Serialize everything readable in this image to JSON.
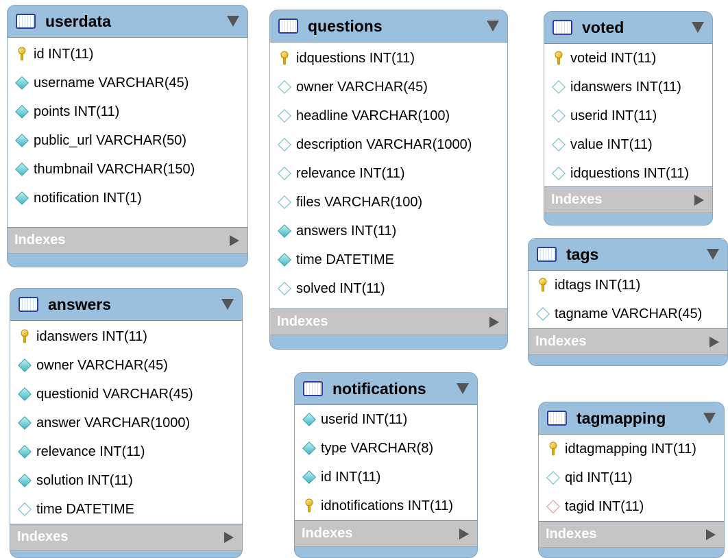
{
  "indexes_label": "Indexes",
  "tables": {
    "userdata": {
      "name": "userdata",
      "columns": [
        {
          "text": "id INT(11)",
          "icon": "key-icon"
        },
        {
          "text": "username VARCHAR(45)",
          "icon": "filled-diamond-icon"
        },
        {
          "text": "points INT(11)",
          "icon": "filled-diamond-icon"
        },
        {
          "text": "public_url VARCHAR(50)",
          "icon": "filled-diamond-icon"
        },
        {
          "text": "thumbnail VARCHAR(150)",
          "icon": "filled-diamond-icon"
        },
        {
          "text": "notification INT(1)",
          "icon": "filled-diamond-icon"
        }
      ]
    },
    "questions": {
      "name": "questions",
      "columns": [
        {
          "text": "idquestions INT(11)",
          "icon": "key-icon"
        },
        {
          "text": "owner VARCHAR(45)",
          "icon": "hollow-diamond-icon"
        },
        {
          "text": "headline VARCHAR(100)",
          "icon": "hollow-diamond-icon"
        },
        {
          "text": "description VARCHAR(1000)",
          "icon": "hollow-diamond-icon"
        },
        {
          "text": "relevance INT(11)",
          "icon": "hollow-diamond-icon"
        },
        {
          "text": "files VARCHAR(100)",
          "icon": "hollow-diamond-icon"
        },
        {
          "text": "answers INT(11)",
          "icon": "filled-diamond-icon"
        },
        {
          "text": "time DATETIME",
          "icon": "filled-diamond-icon"
        },
        {
          "text": "solved INT(11)",
          "icon": "hollow-diamond-icon"
        }
      ]
    },
    "voted": {
      "name": "voted",
      "columns": [
        {
          "text": "voteid INT(11)",
          "icon": "key-icon"
        },
        {
          "text": "idanswers INT(11)",
          "icon": "hollow-diamond-icon"
        },
        {
          "text": "userid INT(11)",
          "icon": "hollow-diamond-icon"
        },
        {
          "text": "value INT(11)",
          "icon": "hollow-diamond-icon"
        },
        {
          "text": "idquestions INT(11)",
          "icon": "hollow-diamond-icon"
        }
      ]
    },
    "tags": {
      "name": "tags",
      "columns": [
        {
          "text": "idtags INT(11)",
          "icon": "key-icon"
        },
        {
          "text": "tagname VARCHAR(45)",
          "icon": "hollow-diamond-icon"
        }
      ]
    },
    "answers": {
      "name": "answers",
      "columns": [
        {
          "text": "idanswers INT(11)",
          "icon": "key-icon"
        },
        {
          "text": "owner VARCHAR(45)",
          "icon": "filled-diamond-icon"
        },
        {
          "text": "questionid VARCHAR(45)",
          "icon": "filled-diamond-icon"
        },
        {
          "text": "answer VARCHAR(1000)",
          "icon": "filled-diamond-icon"
        },
        {
          "text": "relevance INT(11)",
          "icon": "filled-diamond-icon"
        },
        {
          "text": "solution INT(11)",
          "icon": "filled-diamond-icon"
        },
        {
          "text": "time DATETIME",
          "icon": "hollow-diamond-icon"
        }
      ]
    },
    "notifications": {
      "name": "notifications",
      "columns": [
        {
          "text": "userid INT(11)",
          "icon": "filled-diamond-icon"
        },
        {
          "text": "type VARCHAR(8)",
          "icon": "filled-diamond-icon"
        },
        {
          "text": "id INT(11)",
          "icon": "filled-diamond-icon"
        },
        {
          "text": "idnotifications INT(11)",
          "icon": "key-icon"
        }
      ]
    },
    "tagmapping": {
      "name": "tagmapping",
      "columns": [
        {
          "text": "idtagmapping INT(11)",
          "icon": "key-icon"
        },
        {
          "text": "qid INT(11)",
          "icon": "hollow-diamond-icon"
        },
        {
          "text": "tagid INT(11)",
          "icon": "red-diamond-icon"
        }
      ]
    }
  }
}
